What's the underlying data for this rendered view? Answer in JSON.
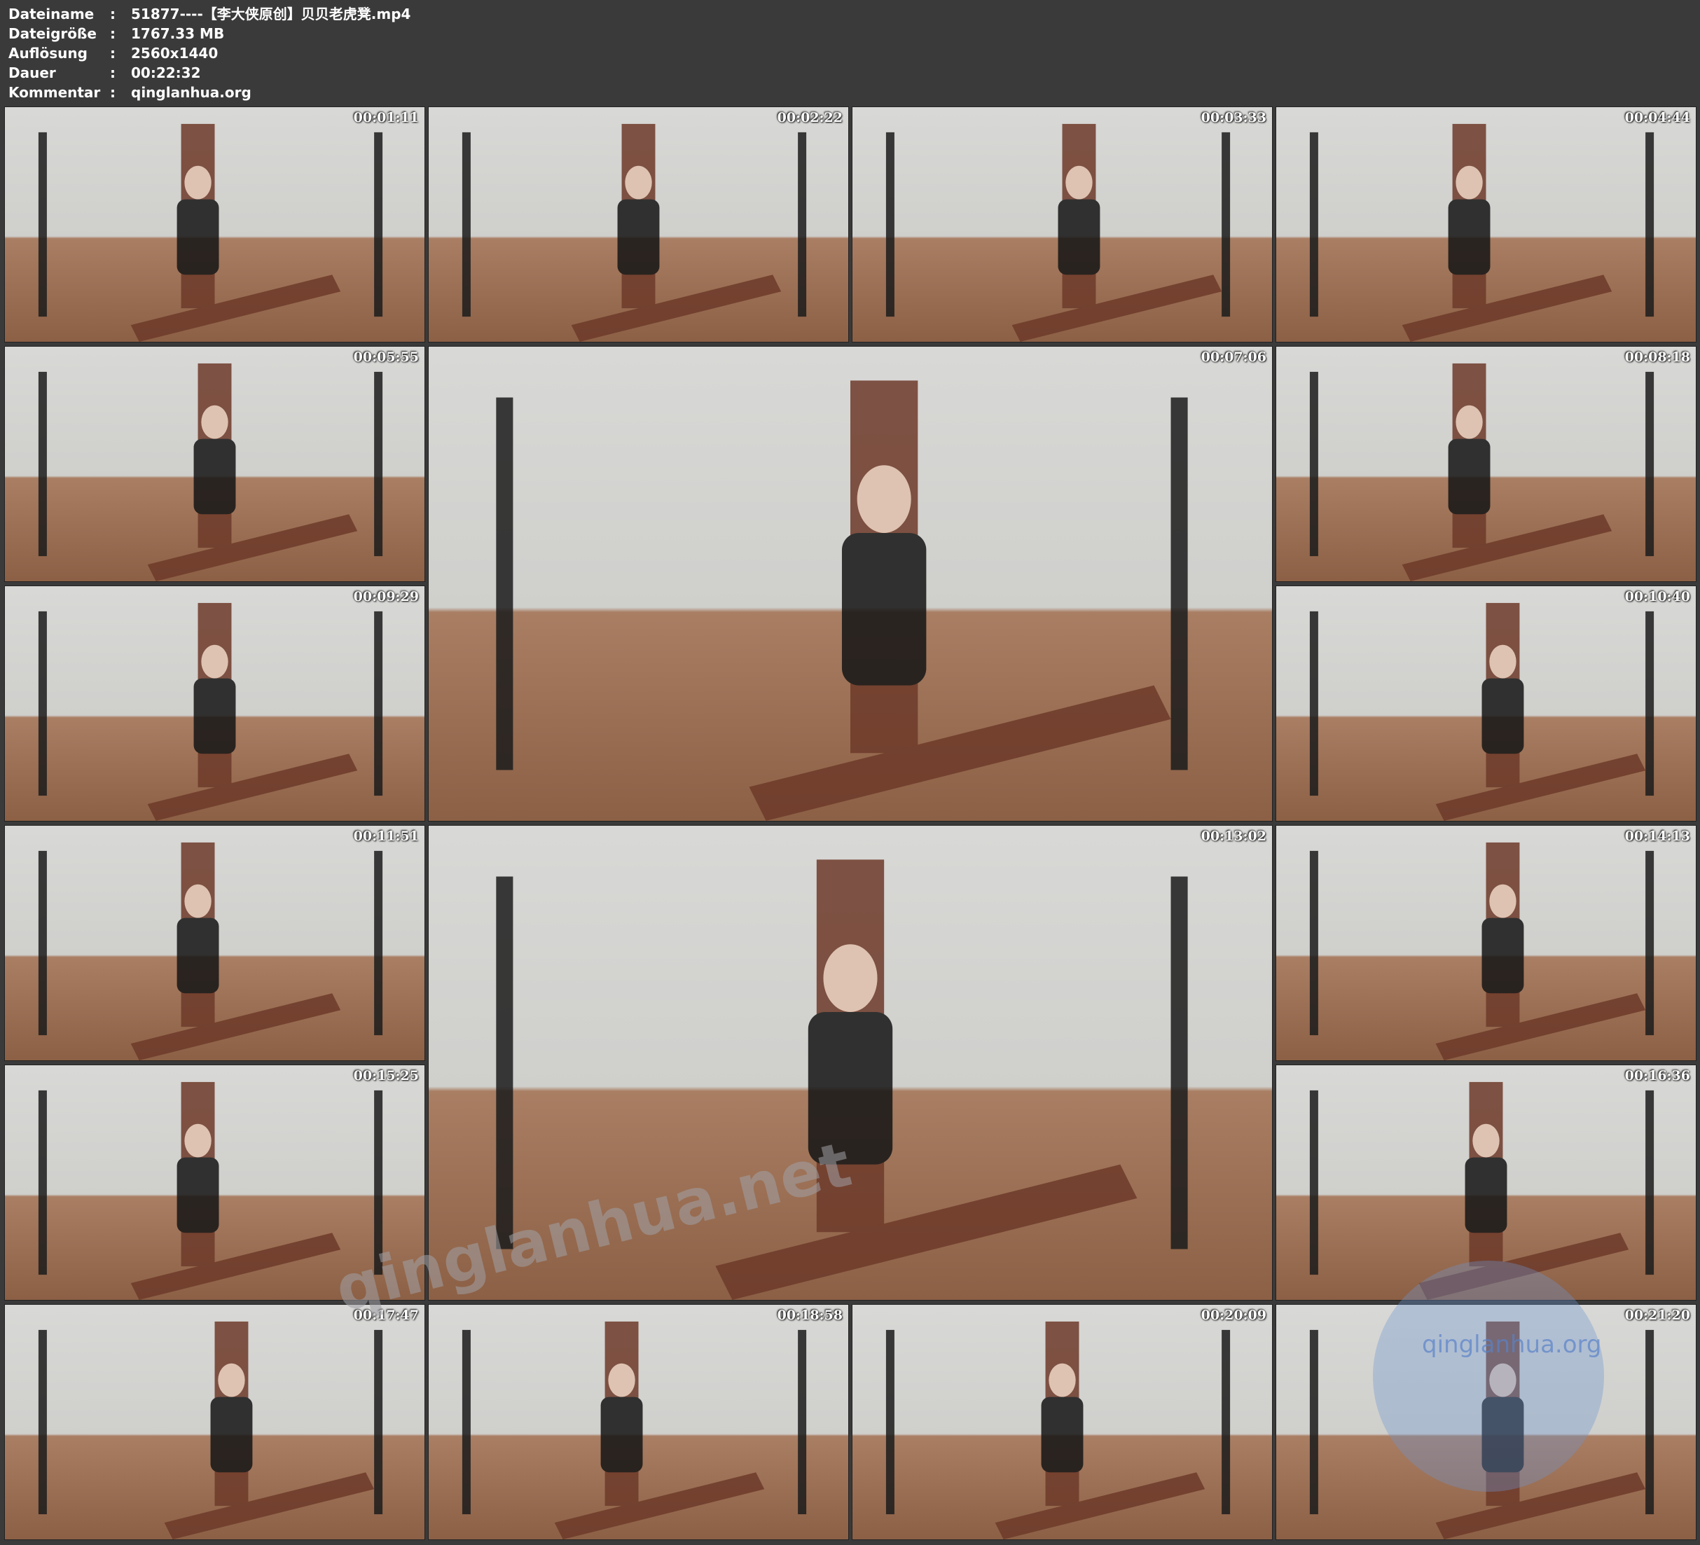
{
  "header": {
    "rows": [
      {
        "label": "Dateiname",
        "colon": ":",
        "value": "51877----【李大侠原创】贝贝老虎凳.mp4"
      },
      {
        "label": "Dateigröße",
        "colon": ":",
        "value": "1767.33 MB"
      },
      {
        "label": "Auflösung",
        "colon": ":",
        "value": "2560x1440"
      },
      {
        "label": "Dauer",
        "colon": ":",
        "value": "00:22:32"
      },
      {
        "label": "Kommentar",
        "colon": ":",
        "value": "qinglanhua.org"
      }
    ]
  },
  "thumbnails": [
    {
      "timestamp": "00:01:11"
    },
    {
      "timestamp": "00:02:22"
    },
    {
      "timestamp": "00:03:33"
    },
    {
      "timestamp": "00:04:44"
    },
    {
      "timestamp": "00:05:55"
    },
    {
      "timestamp": "00:07:06"
    },
    {
      "timestamp": "00:08:18"
    },
    {
      "timestamp": "00:09:29"
    },
    {
      "timestamp": "00:10:40"
    },
    {
      "timestamp": "00:11:51"
    },
    {
      "timestamp": "00:13:02"
    },
    {
      "timestamp": "00:14:13"
    },
    {
      "timestamp": "00:15:25"
    },
    {
      "timestamp": "00:16:36"
    },
    {
      "timestamp": "00:17:47"
    },
    {
      "timestamp": "00:18:58"
    },
    {
      "timestamp": "00:20:09"
    },
    {
      "timestamp": "00:21:20"
    }
  ],
  "watermarks": {
    "diagonal": "qinglanhua.net",
    "corner": "qinglanhua.org"
  },
  "colors": {
    "background": "#3a3a3a",
    "header_text": "#ffffff",
    "wall": "#d8d8d6",
    "floor": "#a97e63",
    "bench": "#6e3a2a"
  }
}
